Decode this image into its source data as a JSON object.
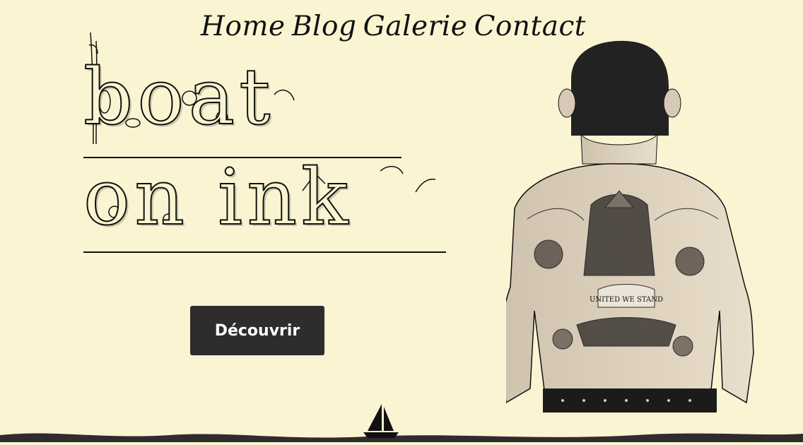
{
  "nav": {
    "items": [
      {
        "label": "Home"
      },
      {
        "label": "Blog"
      },
      {
        "label": "Galerie"
      },
      {
        "label": "Contact"
      }
    ]
  },
  "logo": {
    "line1": "boat",
    "line2": "on ink"
  },
  "hero": {
    "cta_label": "Découvrir",
    "image_alt": "UNITED WE STAND",
    "banner_text": "UNITED WE STAND"
  },
  "colors": {
    "background": "#fbf4d2",
    "button": "#2f2c2d",
    "button_text": "#ffffff",
    "ink": "#111111",
    "wave": "#2f2c2d"
  },
  "icons": {
    "sailboat": "sailboat-icon"
  }
}
